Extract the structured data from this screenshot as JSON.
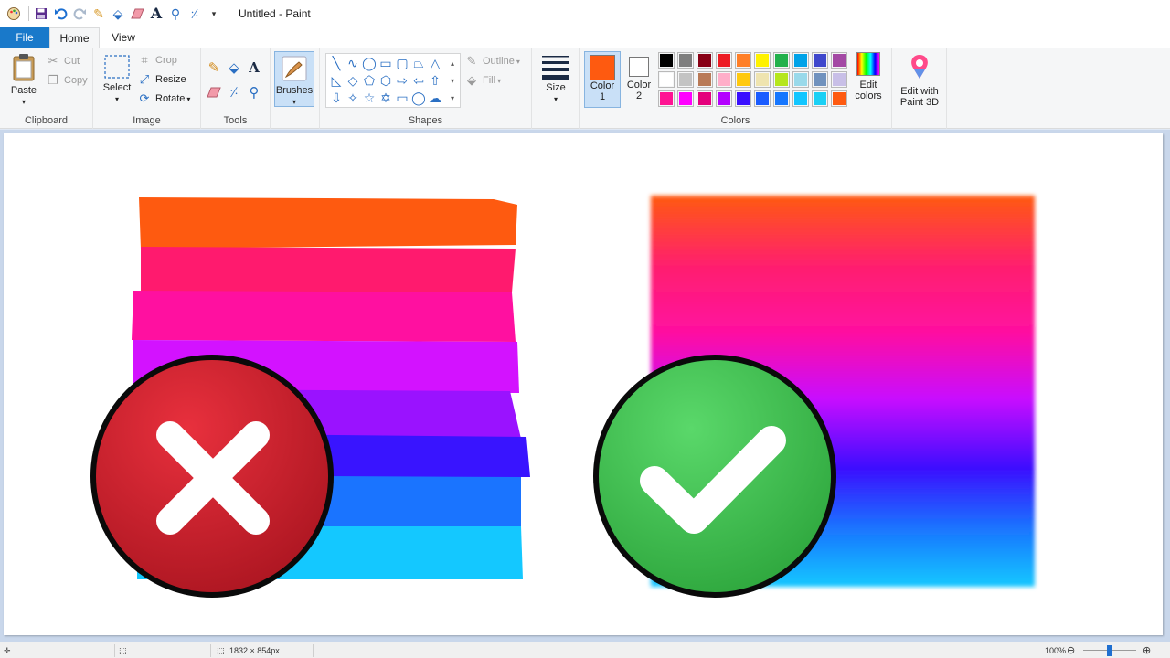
{
  "window": {
    "title": "Untitled - Paint"
  },
  "tabs": {
    "file": "File",
    "home": "Home",
    "view": "View"
  },
  "clipboard": {
    "paste": "Paste",
    "cut": "Cut",
    "copy": "Copy",
    "label": "Clipboard"
  },
  "image": {
    "select": "Select",
    "crop": "Crop",
    "resize": "Resize",
    "rotate": "Rotate",
    "label": "Image"
  },
  "tools": {
    "label": "Tools"
  },
  "brushes": {
    "label": "Brushes"
  },
  "shapes": {
    "outline": "Outline",
    "fill": "Fill",
    "label": "Shapes"
  },
  "size": {
    "label": "Size"
  },
  "colors": {
    "color1": "Color",
    "color1_num": "1",
    "color2": "Color",
    "color2_num": "2",
    "color1_value": "#fe5a10",
    "color2_value": "#ffffff",
    "edit": "Edit",
    "edit2": "colors",
    "label": "Colors",
    "palette_row1": [
      "#000000",
      "#7f7f7f",
      "#880015",
      "#ed1c24",
      "#ff7f27",
      "#fff200",
      "#22b14c",
      "#00a2e8",
      "#3f48cc",
      "#a349a4"
    ],
    "palette_row2": [
      "#ffffff",
      "#c3c3c3",
      "#b97a57",
      "#ffaec9",
      "#ffc90e",
      "#efe4b0",
      "#b5e61d",
      "#99d9ea",
      "#7092be",
      "#c8bfe7"
    ],
    "palette_row3": [
      "#ff1493",
      "#ff00ff",
      "#e4007c",
      "#b400ff",
      "#3a0fff",
      "#1a5cff",
      "#1677ff",
      "#12c6ff",
      "#1ad0f5",
      "#fe5a10"
    ]
  },
  "paint3d": {
    "line1": "Edit with",
    "line2": "Paint 3D"
  },
  "status": {
    "dimensions": "1832 × 854px",
    "zoom": "100%"
  },
  "icons": {
    "app": "paint-palette-icon",
    "save": "save-icon",
    "undo": "undo-icon",
    "redo": "redo-icon"
  }
}
